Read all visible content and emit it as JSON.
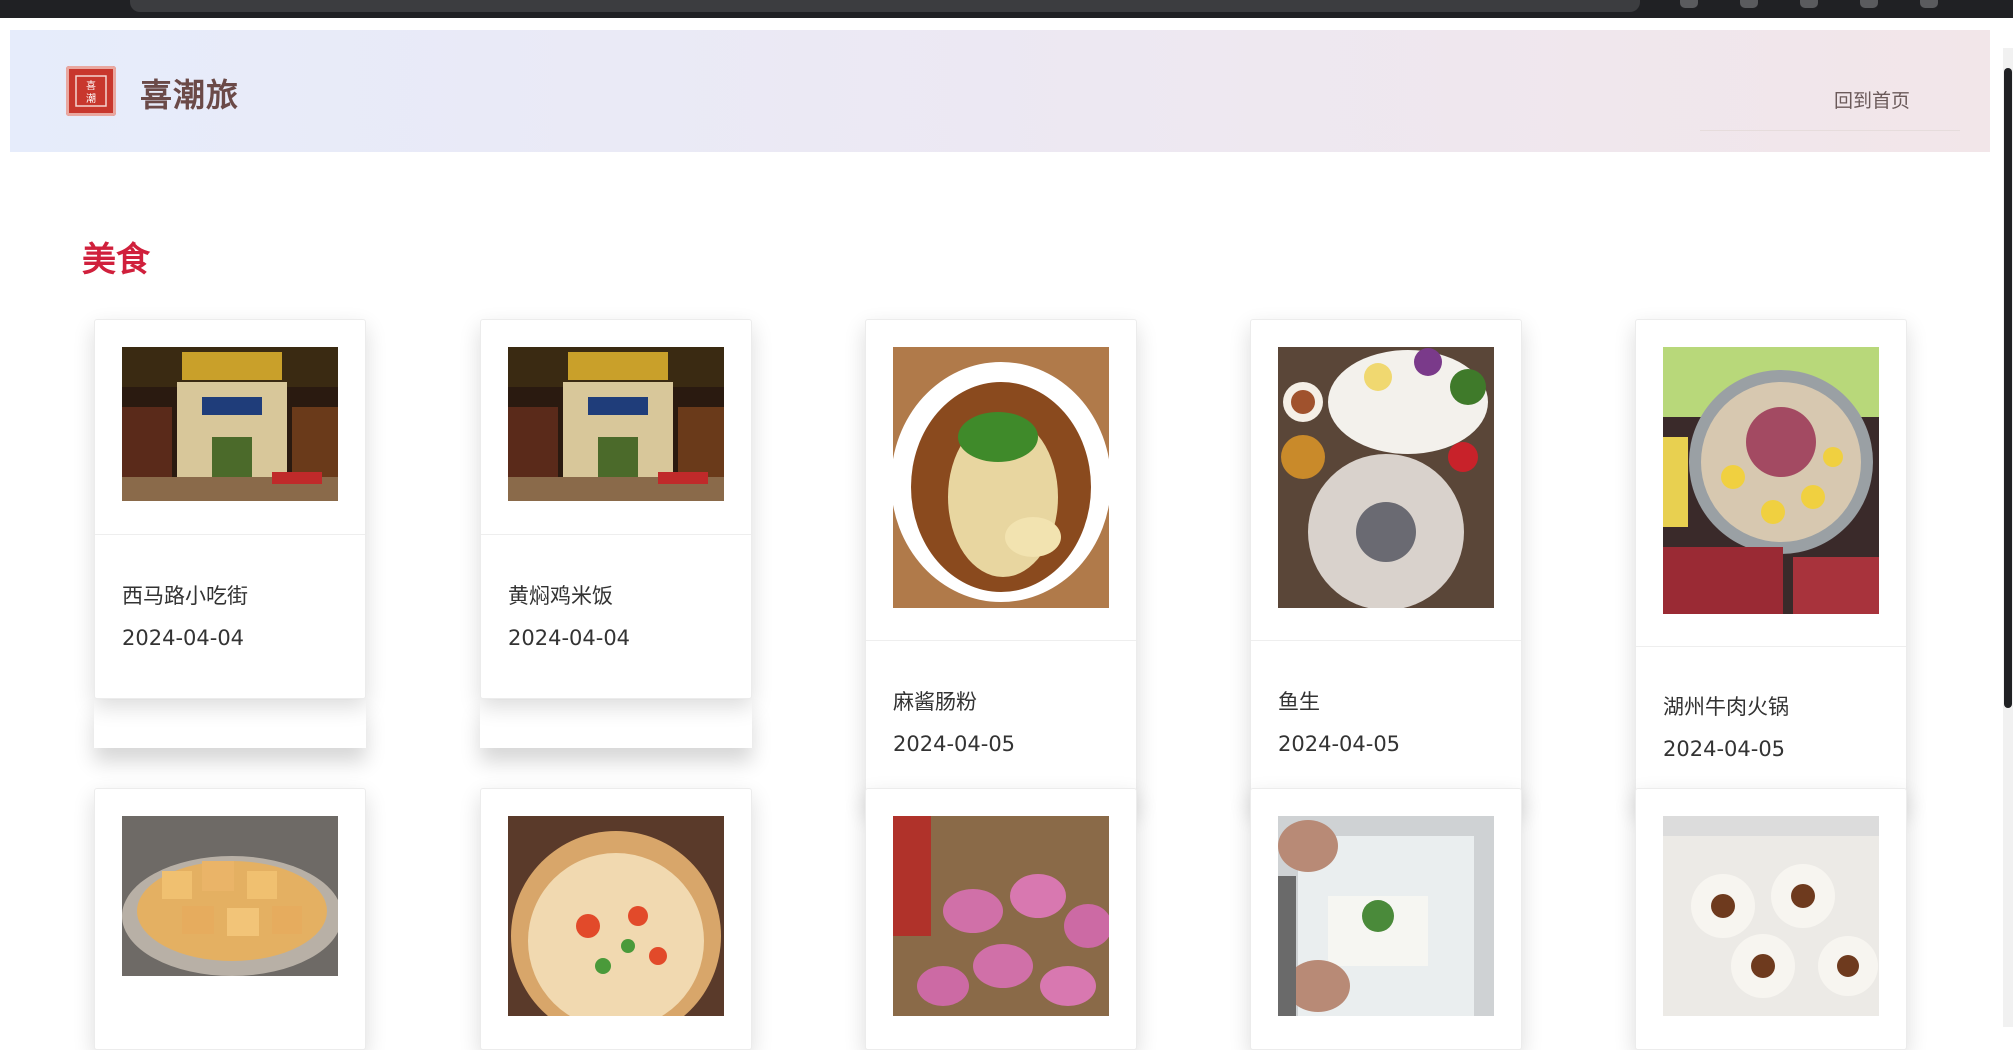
{
  "header": {
    "site_title": "喜潮旅",
    "logo_text": "喜潮",
    "nav_home": "回到首页"
  },
  "section": {
    "title": "美食"
  },
  "cards": [
    {
      "name": "西马路小吃街",
      "date": "2024-04-04",
      "image": "street-night-photo"
    },
    {
      "name": "黄焖鸡米饭",
      "date": "2024-04-04",
      "image": "street-night-photo"
    },
    {
      "name": "麻酱肠粉",
      "date": "2024-04-05",
      "image": "rice-roll-photo"
    },
    {
      "name": "鱼生",
      "date": "2024-04-05",
      "image": "raw-fish-platter-photo"
    },
    {
      "name": "湖州牛肉火锅",
      "date": "2024-04-05",
      "image": "beef-hotpot-photo"
    },
    {
      "name": "",
      "date": "",
      "image": "fried-tofu-photo"
    },
    {
      "name": "",
      "date": "",
      "image": "seafood-congee-photo"
    },
    {
      "name": "",
      "date": "",
      "image": "pink-rice-cake-photo"
    },
    {
      "name": "",
      "date": "",
      "image": "rice-noodle-making-photo"
    },
    {
      "name": "",
      "date": "",
      "image": "steamed-rice-cake-photo"
    }
  ],
  "colors": {
    "accent_red": "#d0203c",
    "title_brown": "#6b4a48",
    "logo_red": "#c8372d"
  }
}
